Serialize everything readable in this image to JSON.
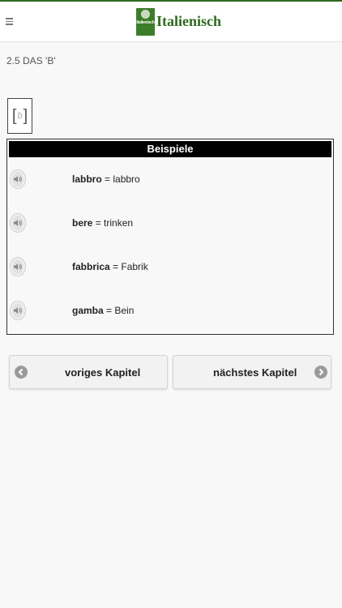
{
  "header": {
    "brand": "Italienisch",
    "logo_text": "Italienisch",
    "menu_icon": "hamburger-menu-icon",
    "logo_icon": "italian-app-logo-icon"
  },
  "chapter": {
    "title": "2.5 DAS 'B'",
    "phoneme": "b",
    "bracket_open": "[",
    "bracket_close": "]"
  },
  "examples": {
    "heading": "Beispiele",
    "items": [
      {
        "word": "labbro",
        "separator": " = ",
        "translation": "labbro",
        "icon": "speaker-icon"
      },
      {
        "word": "bere",
        "separator": " = ",
        "translation": "trinken",
        "icon": "speaker-icon"
      },
      {
        "word": "fabbrica",
        "separator": " = ",
        "translation": "Fabrik",
        "icon": "speaker-icon"
      },
      {
        "word": "gamba",
        "separator": " = ",
        "translation": "Bein",
        "icon": "speaker-icon"
      }
    ]
  },
  "navigation": {
    "previous_label": "voriges Kapitel",
    "next_label": "nächstes Kapitel",
    "previous_icon": "arrow-left-circle-icon",
    "next_icon": "arrow-right-circle-icon"
  },
  "colors": {
    "brand_green": "#2d6a1e",
    "heading_bg": "#000000",
    "background": "#f8f8f8"
  }
}
